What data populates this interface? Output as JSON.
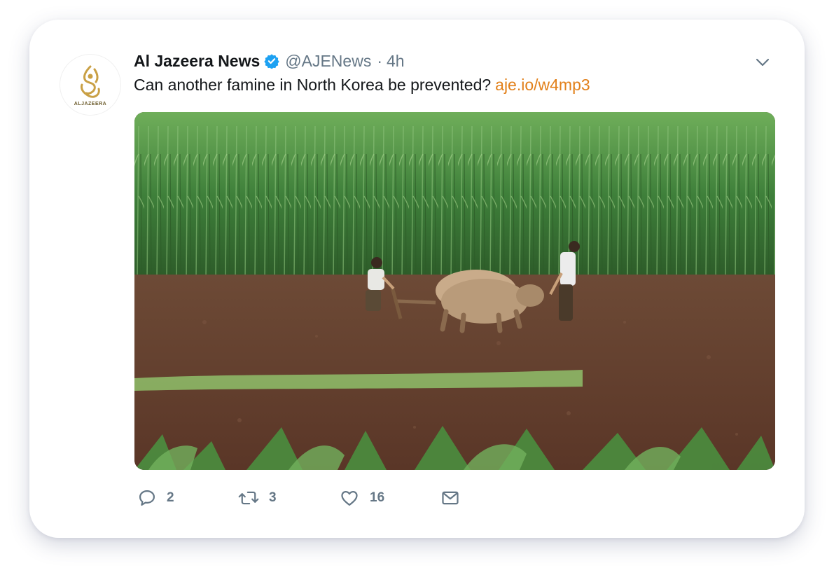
{
  "tweet": {
    "display_name": "Al Jazeera News",
    "handle": "@AJENews",
    "separator": "·",
    "time": "4h",
    "text": "Can another famine in North Korea be prevented?",
    "link": "aje.io/w4mp3",
    "avatar_wordmark": "ALJAZEERA",
    "media_alt_icon": "photo-plowing-field"
  },
  "actions": {
    "reply_count": "2",
    "retweet_count": "3",
    "like_count": "16"
  },
  "icons": {
    "verified": "verified-badge-icon",
    "caret": "chevron-down-icon",
    "reply": "reply-icon",
    "retweet": "retweet-icon",
    "like": "heart-icon",
    "dm": "envelope-icon"
  },
  "colors": {
    "link": "#e2801a",
    "verified": "#1da1f2",
    "muted": "#657786",
    "text": "#14171a"
  }
}
